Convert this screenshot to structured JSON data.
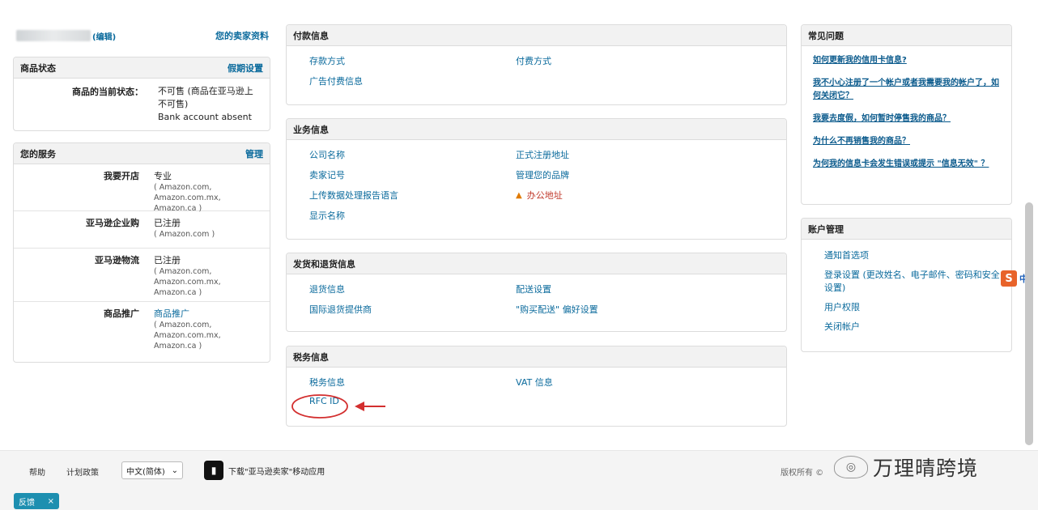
{
  "profile": {
    "edit_label": "(编辑)",
    "seller_profile_link": "您的卖家资料"
  },
  "listing_status": {
    "title": "商品状态",
    "action": "假期设置",
    "label": "商品的当前状态：",
    "value_line1": "不可售 (商品在亚马逊上",
    "value_line2": "不可售)",
    "value_line3": "Bank account absent"
  },
  "services": {
    "title": "您的服务",
    "action": "管理",
    "rows": [
      {
        "name": "我要开店",
        "value": "专业",
        "sub1": "( Amazon.com,",
        "sub2": "Amazon.com.mx,",
        "sub3": "Amazon.ca )"
      },
      {
        "name": "亚马逊企业购",
        "value": "已注册",
        "sub1": "( Amazon.com )",
        "sub2": "",
        "sub3": ""
      },
      {
        "name": "亚马逊物流",
        "value": "已注册",
        "sub1": "( Amazon.com,",
        "sub2": "Amazon.com.mx,",
        "sub3": "Amazon.ca )"
      },
      {
        "name": "商品推广",
        "value": "商品推广",
        "sub1": "( Amazon.com,",
        "sub2": "Amazon.com.mx,",
        "sub3": "Amazon.ca )"
      }
    ]
  },
  "payment_info": {
    "title": "付款信息",
    "links": [
      "存款方式",
      "付费方式",
      "广告付费信息"
    ]
  },
  "business_info": {
    "title": "业务信息",
    "links": [
      "公司名称",
      "正式注册地址",
      "卖家记号",
      "管理您的品牌",
      "上传数据处理报告语言",
      "办公地址",
      "显示名称"
    ]
  },
  "shipping_info": {
    "title": "发货和退货信息",
    "links": [
      "退货信息",
      "配送设置",
      "国际退货提供商",
      "\"购买配送\" 偏好设置"
    ]
  },
  "tax_info": {
    "title": "税务信息",
    "links": [
      "税务信息",
      "VAT 信息",
      "RFC ID"
    ]
  },
  "faq": {
    "title": "常见问题",
    "items": [
      "如何更新我的信用卡信息?",
      "我不小心注册了一个帐户或者我需要我的帐户了，如何关闭它？",
      "我要去度假，如何暂时停售我的商品？",
      "为什么不再销售我的商品？",
      "为何我的信息卡会发生错误或提示 \"信息无效\" ？"
    ]
  },
  "account_mgmt": {
    "title": "账户管理",
    "links": [
      "通知首选项",
      "登录设置 (更改姓名、电子邮件、密码和安全设置)",
      "用户权限",
      "关闭帐户"
    ]
  },
  "footer": {
    "help": "帮助",
    "plan": "计划政策",
    "language": "中文(简体)",
    "app_download": "下载\"亚马逊卖家\"移动应用",
    "copyright": "版权所有 ©",
    "brand_name": "万理晴跨境"
  },
  "feedback": {
    "label": "反馈",
    "close": "×"
  },
  "ime": {
    "s": "S",
    "zh": "中"
  },
  "colors": {
    "link": "#0a6a9c",
    "warning": "#c0392b",
    "annotation": "#d32f2f"
  }
}
